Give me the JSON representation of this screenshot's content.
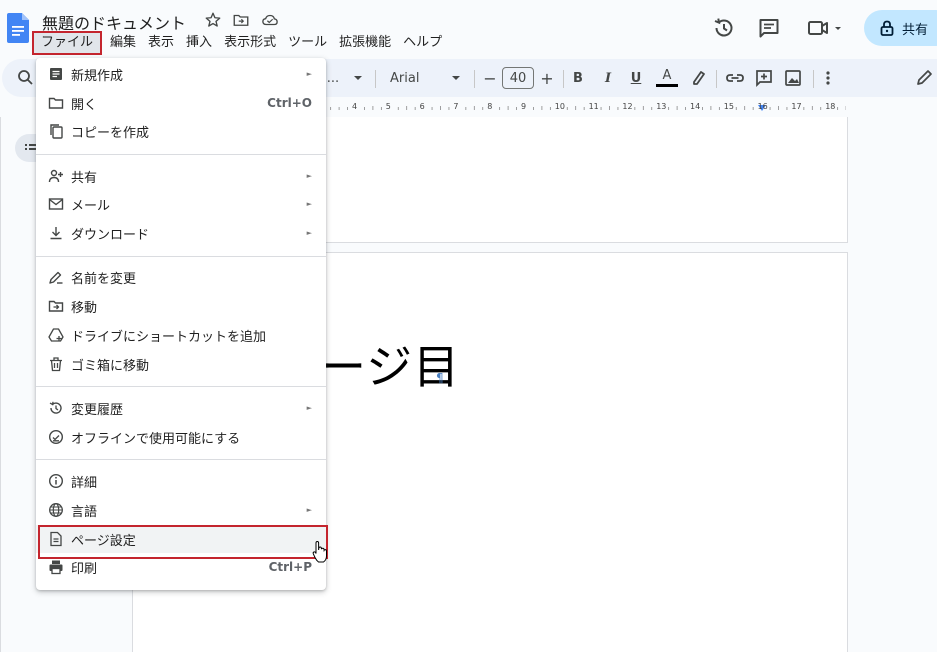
{
  "header": {
    "doc_title": "無題のドキュメント",
    "share_label": "共有"
  },
  "menubar": {
    "items": [
      "ファイル",
      "編集",
      "表示",
      "挿入",
      "表示形式",
      "ツール",
      "拡張機能",
      "ヘルプ"
    ]
  },
  "toolbar": {
    "style_label": "...",
    "font_name": "Arial",
    "font_size": "40",
    "minus": "−",
    "plus": "+",
    "bold": "B",
    "italic": "I",
    "underline": "U",
    "text_color": "A"
  },
  "ruler": {
    "ticks": [
      "4",
      "5",
      "6",
      "7",
      "8",
      "9",
      "10",
      "11",
      "12",
      "13",
      "14",
      "15",
      "16",
      "17",
      "18"
    ]
  },
  "document": {
    "visible_text": "ージ目",
    "pilcrow": "¶"
  },
  "file_menu": {
    "items": [
      {
        "label": "新規作成",
        "icon": "new-doc-icon",
        "submenu": true
      },
      {
        "label": "開く",
        "icon": "folder-icon",
        "shortcut": "Ctrl+O"
      },
      {
        "label": "コピーを作成",
        "icon": "copy-icon"
      },
      {
        "label": "共有",
        "icon": "person-add-icon",
        "submenu": true
      },
      {
        "label": "メール",
        "icon": "mail-icon",
        "submenu": true
      },
      {
        "label": "ダウンロード",
        "icon": "download-icon",
        "submenu": true
      },
      {
        "label": "名前を変更",
        "icon": "rename-icon"
      },
      {
        "label": "移動",
        "icon": "move-folder-icon"
      },
      {
        "label": "ドライブにショートカットを追加",
        "icon": "drive-shortcut-icon"
      },
      {
        "label": "ゴミ箱に移動",
        "icon": "trash-icon"
      },
      {
        "label": "変更履歴",
        "icon": "history-icon",
        "submenu": true
      },
      {
        "label": "オフラインで使用可能にする",
        "icon": "offline-icon"
      },
      {
        "label": "詳細",
        "icon": "info-icon"
      },
      {
        "label": "言語",
        "icon": "globe-icon",
        "submenu": true
      },
      {
        "label": "ページ設定",
        "icon": "page-icon",
        "highlighted": true
      },
      {
        "label": "印刷",
        "icon": "print-icon",
        "shortcut": "Ctrl+P"
      }
    ],
    "submenu_arrow": "►"
  },
  "colors": {
    "highlight_border": "#c4252e",
    "share_bg": "#c2e7ff",
    "toolbar_bg": "#edf2fa",
    "doc_blue": "#4285f4"
  }
}
